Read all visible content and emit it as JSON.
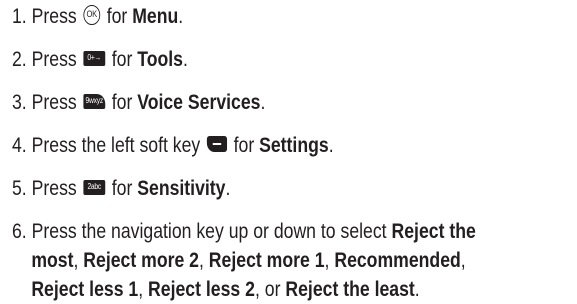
{
  "steps": [
    {
      "num": "1.",
      "before": "Press",
      "key_label": "OK",
      "middle": "for",
      "bold": "Menu",
      "after": "."
    },
    {
      "num": "2.",
      "before": "Press",
      "key_label": "0+→",
      "middle": "for",
      "bold": "Tools",
      "after": "."
    },
    {
      "num": "3.",
      "before": "Press",
      "key_label": "9wxyz",
      "middle": "for",
      "bold": "Voice Services",
      "after": "."
    },
    {
      "num": "4.",
      "before": "Press the left soft key",
      "middle": "for",
      "bold": "Settings",
      "after": "."
    },
    {
      "num": "5.",
      "before": "Press",
      "key_label": "2abc",
      "middle": "for",
      "bold": "Sensitivity",
      "after": "."
    },
    {
      "num": "6.",
      "intro": "Press the navigation key up or down to select",
      "options": [
        "Reject the most",
        "Reject more 2",
        "Reject more 1",
        "Recommended",
        "Reject less 1",
        "Reject less 2",
        "Reject the least"
      ],
      "separator": ",",
      "conjunction": "or",
      "after": "."
    }
  ]
}
